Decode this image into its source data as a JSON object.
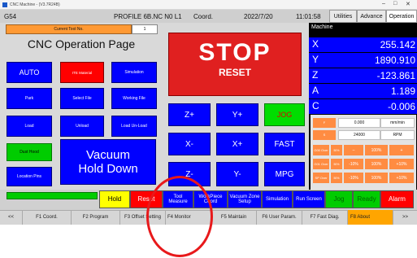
{
  "titlebar": {
    "text": "CNC Machine - (V3.7R24B)",
    "minimize": "–",
    "maximize": "□",
    "close": "✕"
  },
  "header": {
    "workcoord": "G54",
    "program": "PROFILE 6B.NC N0 L1",
    "mode": "Coord.",
    "date": "2022/7/20",
    "time": "11:01:58",
    "tabs": [
      "Utilities",
      "Advance",
      "Operation"
    ]
  },
  "left": {
    "current_tool_label": "Current Tool No.",
    "current_tool_value": "1",
    "page_title": "CNC Operation Page",
    "buttons": {
      "auto": "AUTO",
      "ite_material": "ITE Material",
      "simulation": "Simulation",
      "park": "Park",
      "select_file": "Select File",
      "working_file": "Working File",
      "load": "Load",
      "unload": "Unload",
      "load_unload": "Load Un-Load",
      "dust_hood": "Dust Hood",
      "location_pins": "Location Pins"
    },
    "vacuum": {
      "line1": "Vacuum",
      "line2": "Hold Down"
    }
  },
  "middle": {
    "stop": "STOP",
    "reset": "RESET",
    "jog": {
      "zplus": "Z+",
      "yplus": "Y+",
      "jog": "JOG",
      "xminus": "X-",
      "xplus": "X+",
      "fast": "FAST",
      "zminus": "Z-",
      "yminus": "Y-",
      "mpg": "MPG"
    }
  },
  "right": {
    "machine_label": "Machine",
    "axes": [
      {
        "name": "X",
        "value": "255.142"
      },
      {
        "name": "Y",
        "value": "1890.910"
      },
      {
        "name": "Z",
        "value": "-123.861"
      },
      {
        "name": "A",
        "value": "1.189"
      },
      {
        "name": "C",
        "value": "-0.006"
      }
    ],
    "feed": {
      "label": "F",
      "value": "0.000",
      "unit": "mm/min"
    },
    "spindle": {
      "label": "S",
      "value": "24000",
      "unit": "RPM"
    },
    "overrides": [
      {
        "label": "G00 Over",
        "pct": "50%",
        "minus": "–",
        "value": "100%",
        "plus": "+"
      },
      {
        "label": "G01 Over",
        "pct": "50%",
        "minus": "-10%",
        "value": "100%",
        "plus": "+10%"
      },
      {
        "label": "SP Over",
        "pct": "50%",
        "minus": "-10%",
        "value": "100%",
        "plus": "+10%"
      }
    ]
  },
  "status_strip": {
    "hold": "Hold",
    "reset": "Reset",
    "tool_measure": "Tool Measure",
    "workpiece_coord": "WorkPiece Coord",
    "vacuum_zone_setup": "Vacuum Zone Setup",
    "simulation": "Simulation",
    "run_screen": "Run Screen",
    "jog": "Jog",
    "ready": "Ready",
    "alarm": "Alarm"
  },
  "fkeys": [
    "<<",
    "F1 Coord.",
    "F2 Program",
    "F3 Offset Setting",
    "F4 Monitor",
    "F5 Maintain",
    "F6 User Param.",
    "F7 Fast Diag.",
    "F8 About",
    ">>"
  ],
  "colors": {
    "accent_blue": "#0000ff",
    "stop_red": "#e02020",
    "orange": "#ff8c42",
    "green": "#00cc00",
    "annotation_circle": "#e8191b"
  }
}
